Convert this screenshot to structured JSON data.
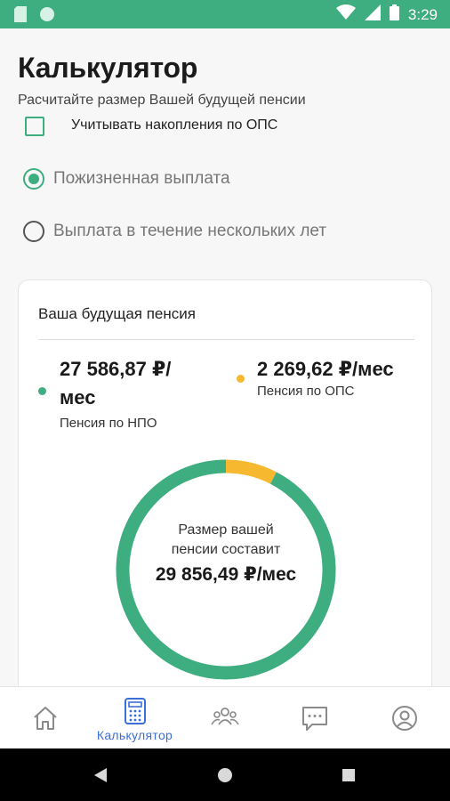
{
  "status_bar": {
    "time": "3:29",
    "color": "#3eae81"
  },
  "page": {
    "title": "Калькулятор",
    "subtitle": "Расчитайте размер Вашей будущей пенсии"
  },
  "options": {
    "ops_checkbox": {
      "label": "Учитывать накопления по ОПС",
      "checked": false
    },
    "payout_type": [
      {
        "label": "Пожизненная выплата",
        "selected": true
      },
      {
        "label": "Выплата в течение нескольких лет",
        "selected": false
      }
    ]
  },
  "result_card": {
    "title": "Ваша будущая пенсия",
    "npo": {
      "amount_line1": "27 586,87 ₽/",
      "amount_line2": "мес",
      "caption": "Пенсия по НПО",
      "color": "#3eae81"
    },
    "ops": {
      "amount": "2 269,62 ₽/мес",
      "caption": "Пенсия по ОПС",
      "color": "#f5b82e"
    },
    "donut": {
      "line1": "Размер вашей",
      "line2": "пенсии составит",
      "total": "29 856,49 ₽/мес",
      "npo_value": 27586.87,
      "ops_value": 2269.62
    }
  },
  "bottom_nav": {
    "items": [
      {
        "icon": "home-icon",
        "label": ""
      },
      {
        "icon": "calculator-icon",
        "label": "Калькулятор",
        "active": true
      },
      {
        "icon": "people-icon",
        "label": ""
      },
      {
        "icon": "chat-icon",
        "label": ""
      },
      {
        "icon": "profile-icon",
        "label": ""
      }
    ],
    "active_color": "#3a6fd8",
    "inactive_color": "#8a8a8a"
  }
}
